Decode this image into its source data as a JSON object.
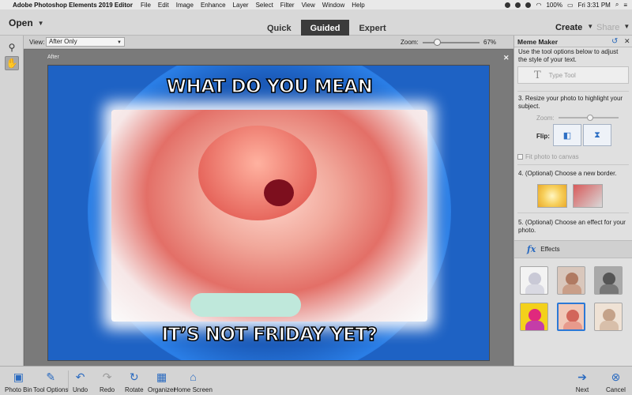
{
  "menubar": {
    "app_name": "Adobe Photoshop Elements 2019 Editor",
    "items": [
      "File",
      "Edit",
      "Image",
      "Enhance",
      "Layer",
      "Select",
      "Filter",
      "View",
      "Window",
      "Help"
    ],
    "battery": "100%",
    "time": "Fri 3:31 PM"
  },
  "topbar": {
    "open_label": "Open",
    "modes": [
      "Quick",
      "Guided",
      "Expert"
    ],
    "active_mode": "Guided",
    "create_label": "Create",
    "share_label": "Share"
  },
  "options": {
    "view_label": "View:",
    "view_value": "After Only",
    "zoom_label": "Zoom:",
    "zoom_value": "67%",
    "zoom_fraction": 0.25
  },
  "canvas": {
    "after_label": "After",
    "close_label": "✕",
    "meme_top": "WHAT DO YOU MEAN",
    "meme_bottom": "IT’S NOT FRIDAY YET?"
  },
  "panel": {
    "title": "Meme Maker",
    "intro_text": "Use the tool options below to adjust the style of your text.",
    "type_tool_label": "Type Tool",
    "step3": "3. Resize your photo to highlight your subject.",
    "zoom_label": "Zoom:",
    "flip_label": "Flip:",
    "fit_label": "Fit photo to canvas",
    "step4": "4. (Optional) Choose a new border.",
    "step5": "5. (Optional) Choose an effect for your photo.",
    "effects_label": "Effects"
  },
  "bottombar": {
    "photo_bin": "Photo Bin",
    "tool_options": "Tool Options",
    "undo": "Undo",
    "redo": "Redo",
    "rotate": "Rotate",
    "organizer": "Organizer",
    "home_screen": "Home Screen",
    "next": "Next",
    "cancel": "Cancel"
  },
  "colors": {
    "accent": "#2a6ac0",
    "mode_active_bg": "#3b3b3b",
    "photo_blue": "#1e62c4"
  }
}
